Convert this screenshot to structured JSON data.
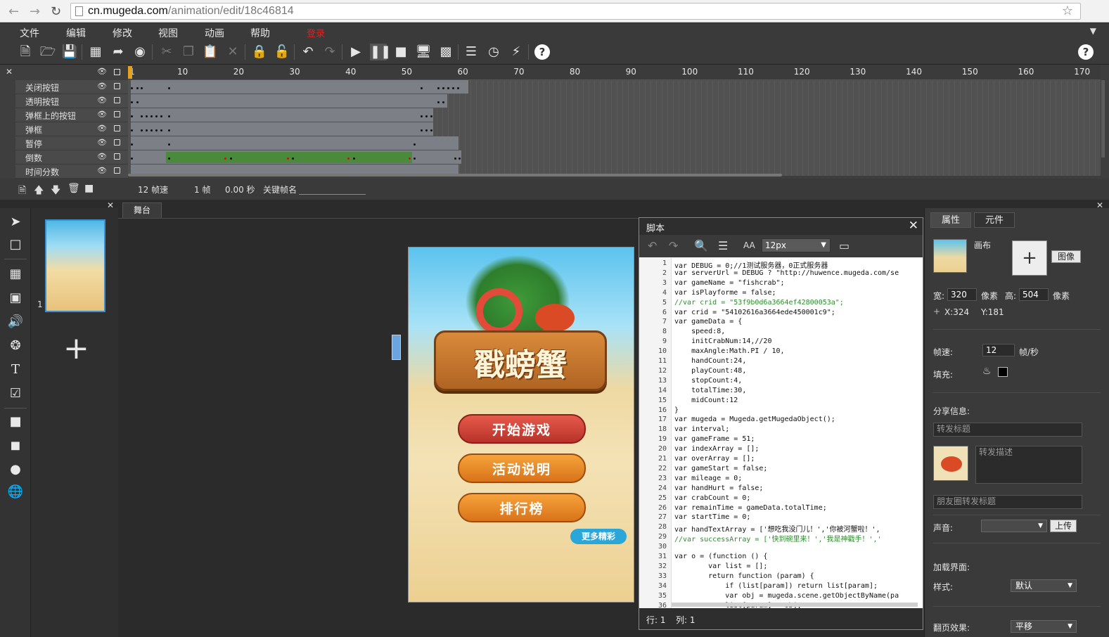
{
  "browser": {
    "url_host": "cn.mugeda.com",
    "url_path": "/animation/edit/18c46814"
  },
  "menu": {
    "file": "文件",
    "edit": "编辑",
    "modify": "修改",
    "view": "视图",
    "animation": "动画",
    "help": "帮助",
    "login": "登录"
  },
  "timeline": {
    "ruler_ticks": [
      "1",
      "10",
      "20",
      "30",
      "40",
      "50",
      "60",
      "70",
      "80",
      "90",
      "100",
      "110",
      "120",
      "130",
      "140",
      "150",
      "160",
      "170"
    ],
    "layers": [
      {
        "name": "关闭按钮"
      },
      {
        "name": "透明按钮"
      },
      {
        "name": "弹框上的按钮"
      },
      {
        "name": "弹框"
      },
      {
        "name": "暂停"
      },
      {
        "name": "倒数"
      },
      {
        "name": "时间分数"
      }
    ],
    "fps_label": "12 帧速",
    "frame_label": "1 帧",
    "time_label": "0.00 秒",
    "keyframe_name_label": "关键帧名"
  },
  "scenes": {
    "items": [
      {
        "number": "1"
      }
    ]
  },
  "stage": {
    "tab_label": "舞台",
    "game": {
      "title": "戳螃蟹",
      "btn_start": "开始游戏",
      "btn_rules": "活动说明",
      "btn_rank": "排行榜",
      "btn_more": "更多精彩"
    }
  },
  "script": {
    "title": "脚本",
    "font_size": "12px",
    "status_row": "行: 1",
    "status_col": "列: 1",
    "line_numbers": [
      "1",
      "2",
      "3",
      "4",
      "5",
      "6",
      "7",
      "8",
      "9",
      "10",
      "11",
      "12",
      "13",
      "14",
      "15",
      "16",
      "17",
      "18",
      "19",
      "20",
      "21",
      "22",
      "23",
      "24",
      "25",
      "26",
      "27",
      "28",
      "29",
      "30",
      "31",
      "32",
      "33",
      "34",
      "35",
      "36"
    ],
    "lines": [
      "var DEBUG = 0;//1测试服务器，0正式服务器",
      "var serverUrl = DEBUG ? \"http://huwence.mugeda.com/se",
      "var gameName = \"fishcrab\";",
      "var isPlayforme = false;",
      "//var crid = \"53f9b0d6a3664ef42800053a\";",
      "var crid = \"54102616a3664ede450001c9\";",
      "var gameData = {",
      "    speed:8,",
      "    initCrabNum:14,//20",
      "    maxAngle:Math.PI / 10,",
      "    handCount:24,",
      "    playCount:48,",
      "    stopCount:4,",
      "    totalTime:30,",
      "    midCount:12",
      "}",
      "var mugeda = Mugeda.getMugedaObject();",
      "var interval;",
      "var gameFrame = 51;",
      "var indexArray = [];",
      "var overArray = [];",
      "var gameStart = false;",
      "var mileage = 0;",
      "var handHurt = false;",
      "var crabCount = 0;",
      "var remainTime = gameData.totalTime;",
      "var startTime = 0;",
      "var handTextArray = ['想吃我没门儿！','你被河蟹啦！',",
      "//var successArray = ['快到碗里来！','我是神戳手！','",
      "",
      "var o = (function () {",
      "        var list = [];",
      "        return function (param) {",
      "            if (list[param]) return list[param];",
      "            var obj = mugeda.scene.getObjectByName(pa",
      "            list[param] = obj;"
    ]
  },
  "properties": {
    "tab_props": "属性",
    "tab_elements": "元件",
    "canvas_label": "画布",
    "image_button": "图像",
    "width_label": "宽:",
    "width_value": "320",
    "width_unit": "像素",
    "height_label": "高:",
    "height_value": "504",
    "height_unit": "像素",
    "coord_x": "X:324",
    "coord_y": "Y:181",
    "fps_label": "帧速:",
    "fps_value": "12",
    "fps_unit": "帧/秒",
    "fill_label": "填充:",
    "fill_color": "#000000",
    "share_label": "分享信息:",
    "share_title_placeholder": "转发标题",
    "share_desc_placeholder": "转发描述",
    "moments_placeholder": "朋友圈转发标题",
    "sound_label": "声音:",
    "upload_button": "上传",
    "loading_label": "加载界面:",
    "style_label": "样式:",
    "style_value": "默认",
    "page_effect_label": "翻页效果:",
    "page_effect_value": "平移"
  }
}
